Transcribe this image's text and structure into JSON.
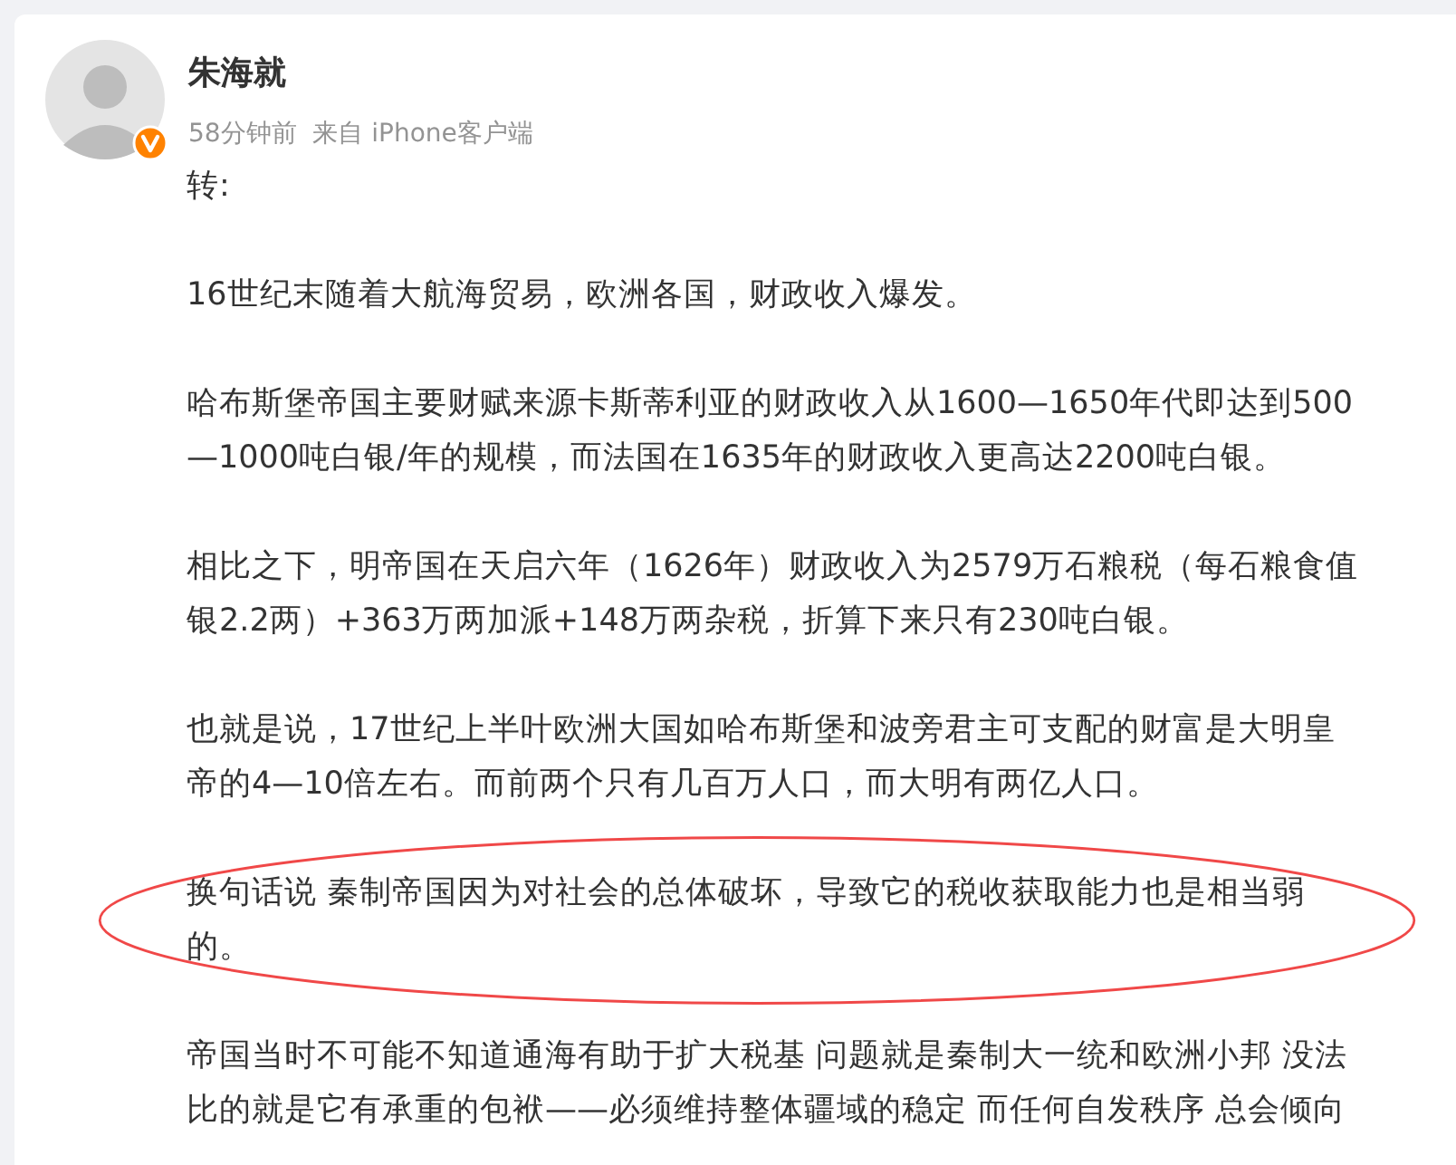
{
  "post": {
    "author": "朱海就",
    "verified": true,
    "meta": "58分钟前  来自 iPhone客户端",
    "paragraphs": [
      {
        "lines": [
          "转:"
        ],
        "circled": false
      },
      {
        "lines": [
          "16世纪末随着大航海贸易，欧洲各国，财政收入爆发。"
        ],
        "circled": false
      },
      {
        "lines": [
          "哈布斯堡帝国主要财赋来源卡斯蒂利亚的财政收入从1600—1650年代即达到500",
          "—1000吨白银/年的规模，而法国在1635年的财政收入更高达2200吨白银。"
        ],
        "circled": false
      },
      {
        "lines": [
          "相比之下，明帝国在天启六年（1626年）财政收入为2579万石粮税（每石粮食值",
          "银2.2两）+363万两加派+148万两杂税，折算下来只有230吨白银。"
        ],
        "circled": false
      },
      {
        "lines": [
          "也就是说，17世纪上半叶欧洲大国如哈布斯堡和波旁君主可支配的财富是大明皇",
          "帝的4—10倍左右。而前两个只有几百万人口，而大明有两亿人口。"
        ],
        "circled": false
      },
      {
        "lines": [
          "换句话说 秦制帝国因为对社会的总体破坏，导致它的税收获取能力也是相当弱",
          "的。"
        ],
        "circled": true
      },
      {
        "lines": [
          "帝国当时不可能不知道通海有助于扩大税基 问题就是秦制大一统和欧洲小邦 没法",
          "比的就是它有承重的包袱——必须维持整体疆域的稳定 而任何自发秩序 总会倾向"
        ],
        "circled": false
      }
    ]
  }
}
